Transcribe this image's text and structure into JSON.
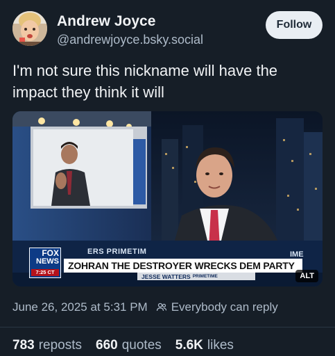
{
  "author": {
    "display_name": "Andrew Joyce",
    "handle": "@andrewjoyce.bsky.social",
    "avatar_icon": "avatar-child-photo"
  },
  "follow_button": {
    "label": "Follow"
  },
  "post": {
    "text": "I'm not sure this nickname will have the impact they think it will"
  },
  "media": {
    "chyron_logo_fox": "FOX",
    "chyron_logo_news": "NEWS",
    "chyron_time": "7:25 CT",
    "chyron_top": "ERS PRIMETIM",
    "chyron_top_right": "IME",
    "chyron_headline": "ZOHRAN THE DESTROYER WRECKS DEM PARTY",
    "chyron_show": "JESSE WATTERS",
    "chyron_show_tag": "PRIMETIME",
    "alt_badge": "ALT"
  },
  "meta": {
    "timestamp": "June 26, 2025 at 5:31 PM",
    "reply_icon": "people-icon",
    "reply_setting": "Everybody can reply"
  },
  "stats": {
    "reposts_count": "783",
    "reposts_label": "reposts",
    "quotes_count": "660",
    "quotes_label": "quotes",
    "likes_count": "5.6K",
    "likes_label": "likes"
  },
  "colors": {
    "background": "#161e27",
    "text_primary": "#f1f3f5",
    "text_secondary": "#aebbc9",
    "follow_bg": "#e9eef3"
  }
}
